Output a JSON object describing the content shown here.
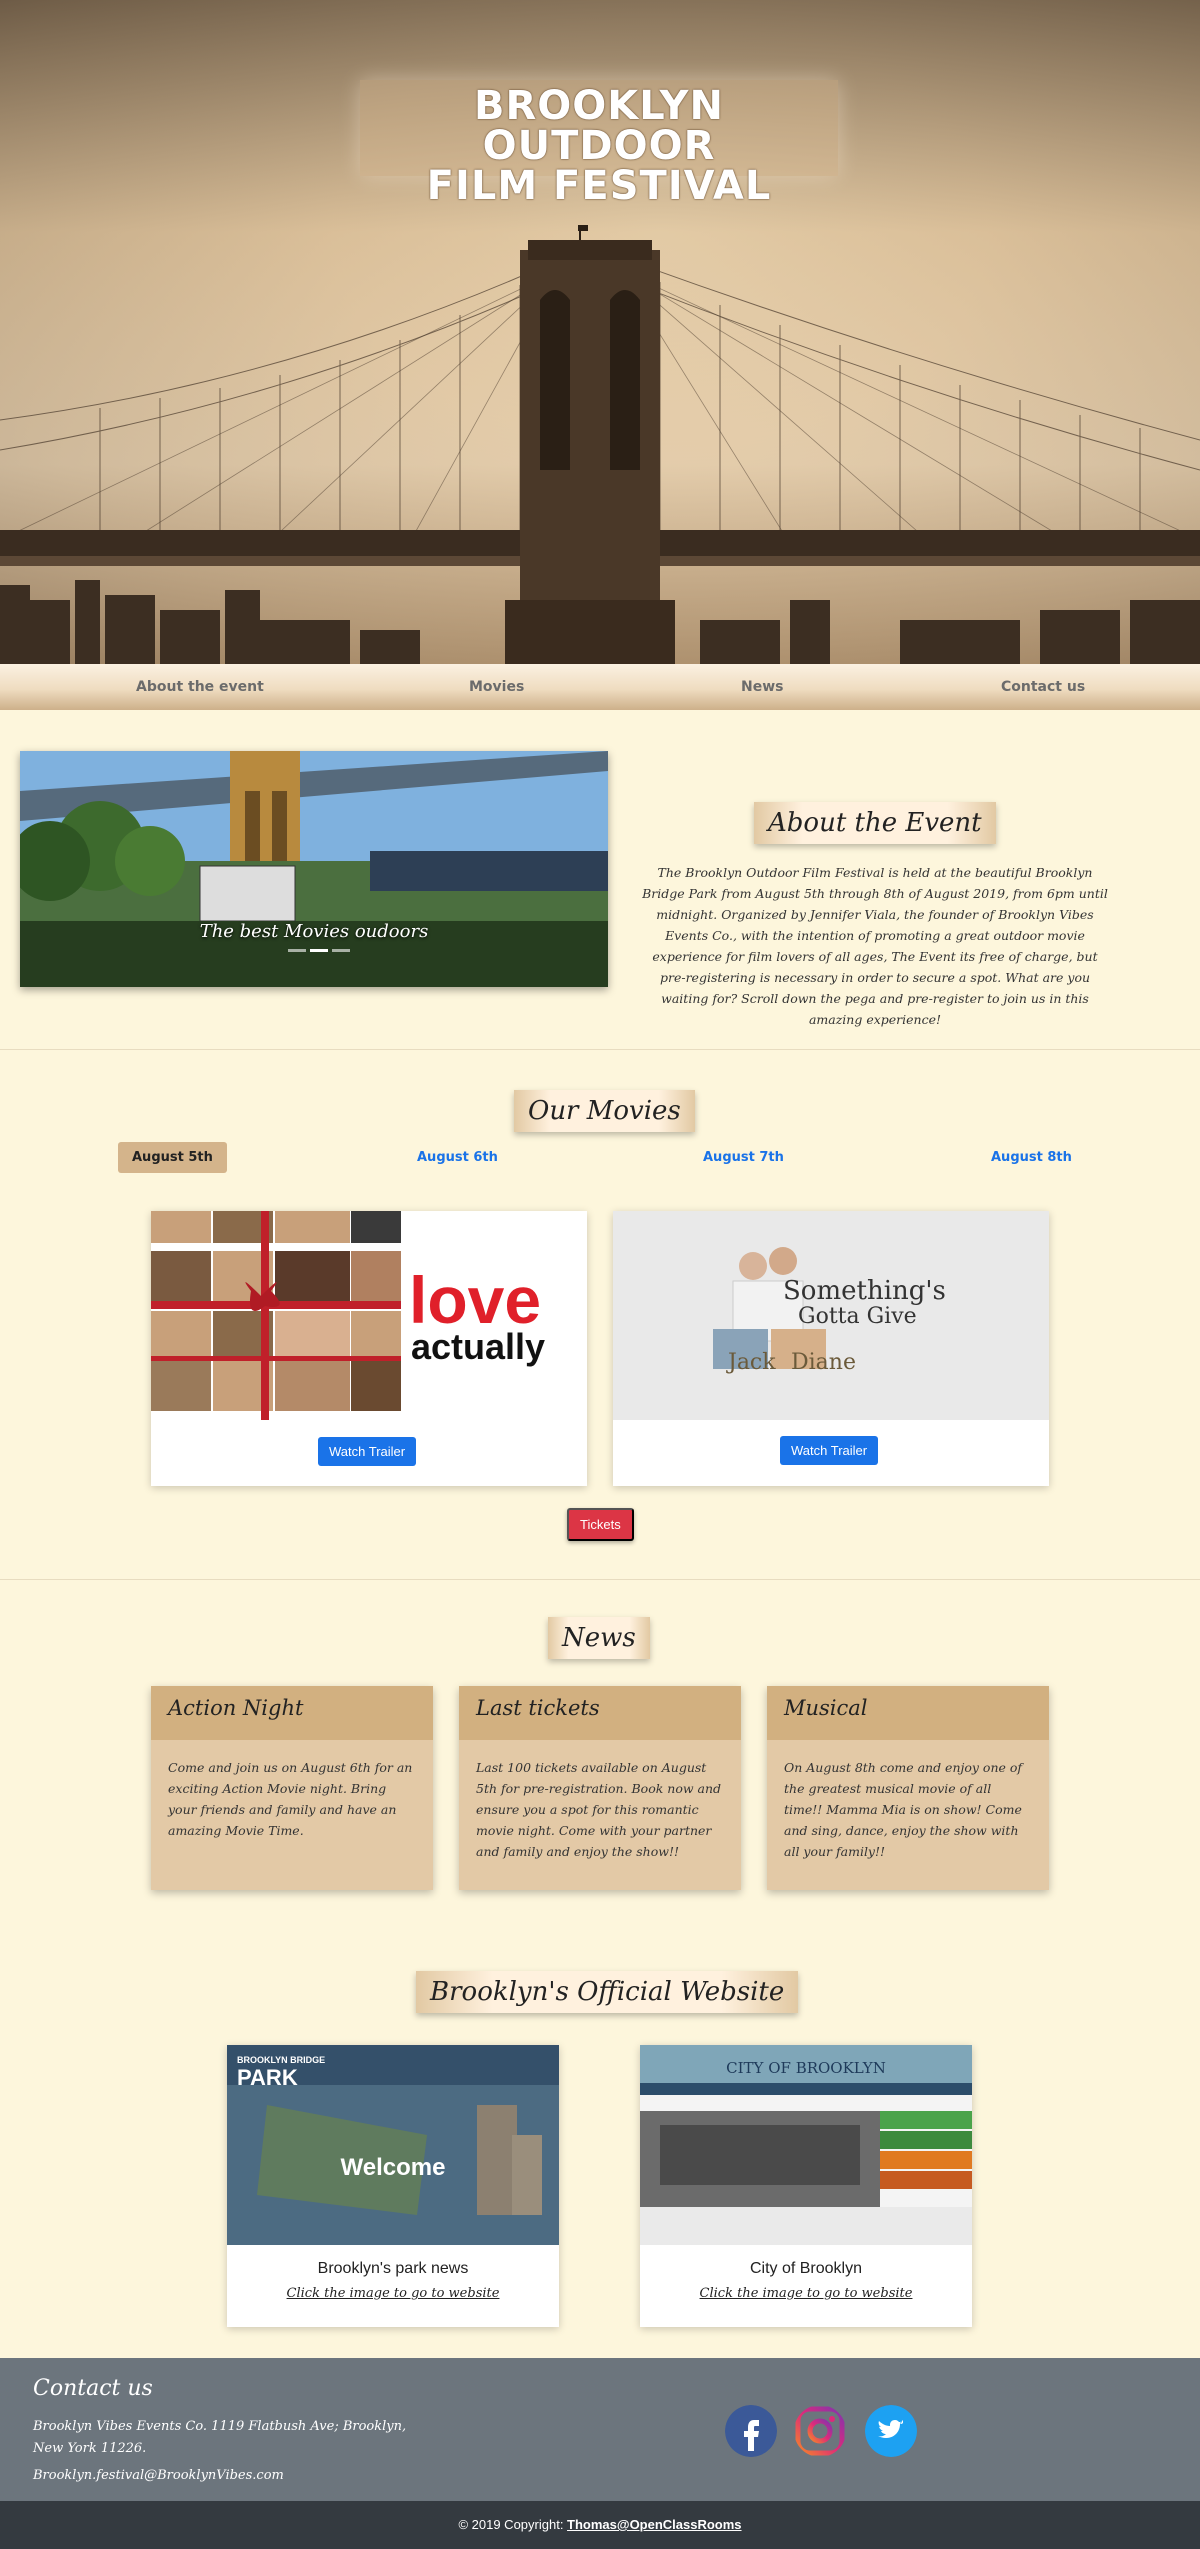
{
  "hero": {
    "title_line1": "BROOKLYN OUTDOOR",
    "title_line2": "FILM FESTIVAL"
  },
  "nav": {
    "items": [
      "About the event",
      "Movies",
      "News",
      "Contact us"
    ]
  },
  "about": {
    "image_caption": "The best Movies oudoors",
    "title": "About the Event",
    "text": "The Brooklyn Outdoor Film Festival is held at the beautiful Brooklyn Bridge Park from August 5th through 8th of August 2019, from 6pm until midnight. Organized by Jennifer Viala, the founder of Brooklyn Vibes Events Co., with the intention of promoting a great outdoor movie experience for film lovers of all ages, The Event its free of charge, but pre-registering is necessary in order to secure a spot. What are you waiting for? Scroll down the pega and pre-register to join us in this amazing experience!"
  },
  "movies": {
    "title": "Our Movies",
    "tabs": [
      "August 5th",
      "August 6th",
      "August 7th",
      "August 8th"
    ],
    "active_tab": "August 5th",
    "cards": [
      {
        "poster_line1": "love",
        "poster_line2": "actually",
        "button": "Watch Trailer"
      },
      {
        "poster_line1": "Something's",
        "poster_line2": "Gotta Give",
        "poster_name1": "Jack",
        "poster_name2": "Diane",
        "button": "Watch Trailer"
      }
    ],
    "tickets_button": "Tickets"
  },
  "news": {
    "title": "News",
    "cards": [
      {
        "title": "Action Night",
        "text": "Come and join us on August 6th for an exciting Action Movie night. Bring your friends and family and have an amazing Movie Time."
      },
      {
        "title": "Last tickets",
        "text": "Last 100 tickets available on August 5th for pre-registration. Book now and ensure you a spot for this romantic movie night. Come with your partner and family and enjoy the show!!"
      },
      {
        "title": "Musical",
        "text": "On August 8th come and enjoy one of the greatest musical movie of all time!! Mamma Mia is on show! Come and sing, dance, enjoy the show with all your family!!"
      }
    ]
  },
  "website": {
    "title": "Brooklyn's Official Website",
    "cards": [
      {
        "name": "Brooklyn's park news",
        "link": "Click the image to go to website",
        "shot_top": "BROOKLYN BRIDGE",
        "shot_big": "PARK",
        "shot_center": "Welcome"
      },
      {
        "name": "City of Brooklyn",
        "link": "Click the image to go to website",
        "shot_top": "CITY OF BROOKLYN"
      }
    ]
  },
  "footer": {
    "title": "Contact us",
    "address": "Brooklyn Vibes Events Co. 1119 Flatbush Ave; Brooklyn, New York 11226.",
    "email": "Brooklyn.festival@BrooklynVibes.com",
    "social": [
      "facebook-icon",
      "instagram-icon",
      "twitter-icon"
    ],
    "copyright_prefix": "© 2019 Copyright: ",
    "copyright_link": "Thomas@OpenClassRooms"
  },
  "colors": {
    "page_bg": "#fdf6dc",
    "nav_bg": "#efdcc0",
    "news_head": "#d2b080",
    "news_body": "#e3c9a6",
    "button_blue": "#1a73e8",
    "button_red": "#dc3545",
    "footer_bg": "#6c757d",
    "copyright_bg": "#343a40"
  }
}
